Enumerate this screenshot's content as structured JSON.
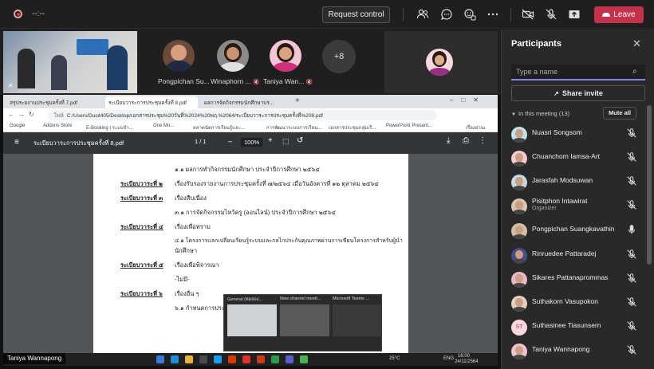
{
  "topbar": {
    "timer": "--:--",
    "request_control": "Request control",
    "leave": "Leave"
  },
  "video_row": {
    "tiles": [
      {
        "name": "Pongpichan Su..."
      },
      {
        "name": "Winaphorn ..."
      },
      {
        "name": "Taniya Wan..."
      }
    ],
    "overflow_count": "+8"
  },
  "browser": {
    "tabs": [
      "สรุประยงานประชุมครั้งที่ 7.pdf",
      "ระเบียบวาระการประชุมครั้งที่ 8.pdf",
      "ผลการจัดกิจกรรมนักศึกษาปร..."
    ],
    "url_secure_label": "ไฟล์",
    "url": "C:/Users/Dusit405/Desktop/เอกสารประชุม%20วันที่%2024%20พฤ.%2064/ระเบียบวาระการประชุมครั้งที่%208.pdf",
    "bookmarks": [
      "Google",
      "Addons Store",
      "E-Booking | ระบบจำ...",
      "One Mo...",
      "ตลาดนัดการเรียนรู้และ...",
      "การพัฒนาระบบการเรียน...",
      "เอกสารประชุมกลุ่มเรี...",
      "PowerPoint Present...",
      "เรื่องอ่านเ"
    ]
  },
  "pdf": {
    "title": "ระเบียบวาระการประชุมครั้งที่ 8.pdf",
    "page": "1",
    "page_total": "/ 1",
    "zoom": "100%",
    "lines": {
      "l1": "๑.๑ ผลการทำกิจกรรมนักศึกษา ประจำปีการศึกษา ๒๕๖๔",
      "a2": "ระเบียบวาระที่ ๒",
      "l2": "เรื่องรับรองรายงานการประชุมครั้งที่ ๗/๒๕๖๔ เมื่อวันอังคารที่ ๑๒ ตุลาคม ๒๕๖๔",
      "a3": "ระเบียบวาระที่ ๓",
      "l3": "เรื่องสืบเนื่อง",
      "l3b": "๓.๑ การจัดกิจกรรมไหว้ครู (ออนไลน์) ประจำปีการศึกษา ๒๕๖๔",
      "a4": "ระเบียบวาระที่ ๔",
      "l4": "เรื่องเพื่อทราบ",
      "l4b": "๔.๑ โครงการแลกเปลี่ยนเรียนรู้ระบบและกลไกประกันคุณภาพผ่านการเขียนโครงการสำหรับผู้นำ",
      "l4c": "นักศึกษา",
      "a5": "ระเบียบวาระที่ ๕",
      "l5": "เรื่องเพื่อพิจารณา",
      "l5b": "-ไม่มี-",
      "a6": "ระเบียบวาระที่ ๖",
      "l6": "เรื่องอื่น ๆ",
      "l6b": "๖.๑ กำหนดการประชุม..."
    }
  },
  "taskbar": {
    "temp": "25°C",
    "lang": "ENG",
    "time": "16:00",
    "date": "24/11/2564",
    "thumbs": [
      "General (ทดลอง...",
      "New channel meeti...",
      "Microsoft Teams ..."
    ]
  },
  "presenter_label": "Taniya Wannapong",
  "panel": {
    "title": "Participants",
    "search_placeholder": "Type a name",
    "share_invite": "Share invite",
    "in_meeting": "In this meeting (13)",
    "mute_all": "Mute all",
    "participants": [
      {
        "name": "Nuasri Songsom",
        "sub": ""
      },
      {
        "name": "Chuanchom Iamsa-Art",
        "sub": ""
      },
      {
        "name": "Jarasfah Modsuwan",
        "sub": ""
      },
      {
        "name": "Pisitphon Intawirat",
        "sub": "Organizer"
      },
      {
        "name": "Pongpichan Suangkavathin",
        "sub": ""
      },
      {
        "name": "Rinruedee Pattaradej",
        "sub": ""
      },
      {
        "name": "Sikares Pattanaprommas",
        "sub": ""
      },
      {
        "name": "Suthakorn Vasupokon",
        "sub": ""
      },
      {
        "name": "Suthasinee Tiasunsern",
        "sub": "",
        "initials": "ST"
      },
      {
        "name": "Taniya Wannapong",
        "sub": ""
      }
    ]
  }
}
